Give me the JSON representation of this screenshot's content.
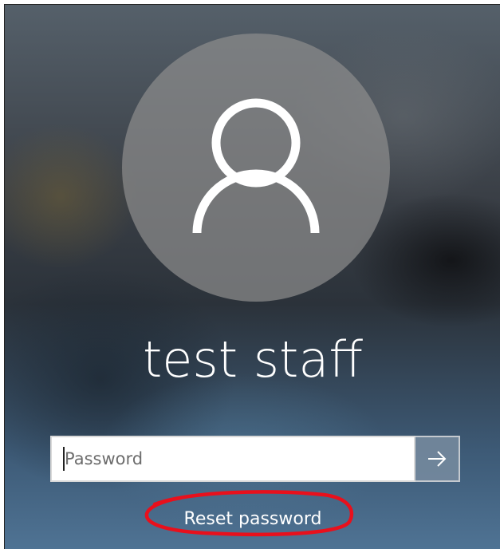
{
  "user": {
    "display_name": "test staff",
    "avatar_icon": "user-silhouette-icon"
  },
  "password": {
    "value": "",
    "placeholder": "Password",
    "submit_icon": "arrow-right-icon"
  },
  "reset": {
    "label": "Reset password",
    "annotation_color": "#e8101c"
  }
}
